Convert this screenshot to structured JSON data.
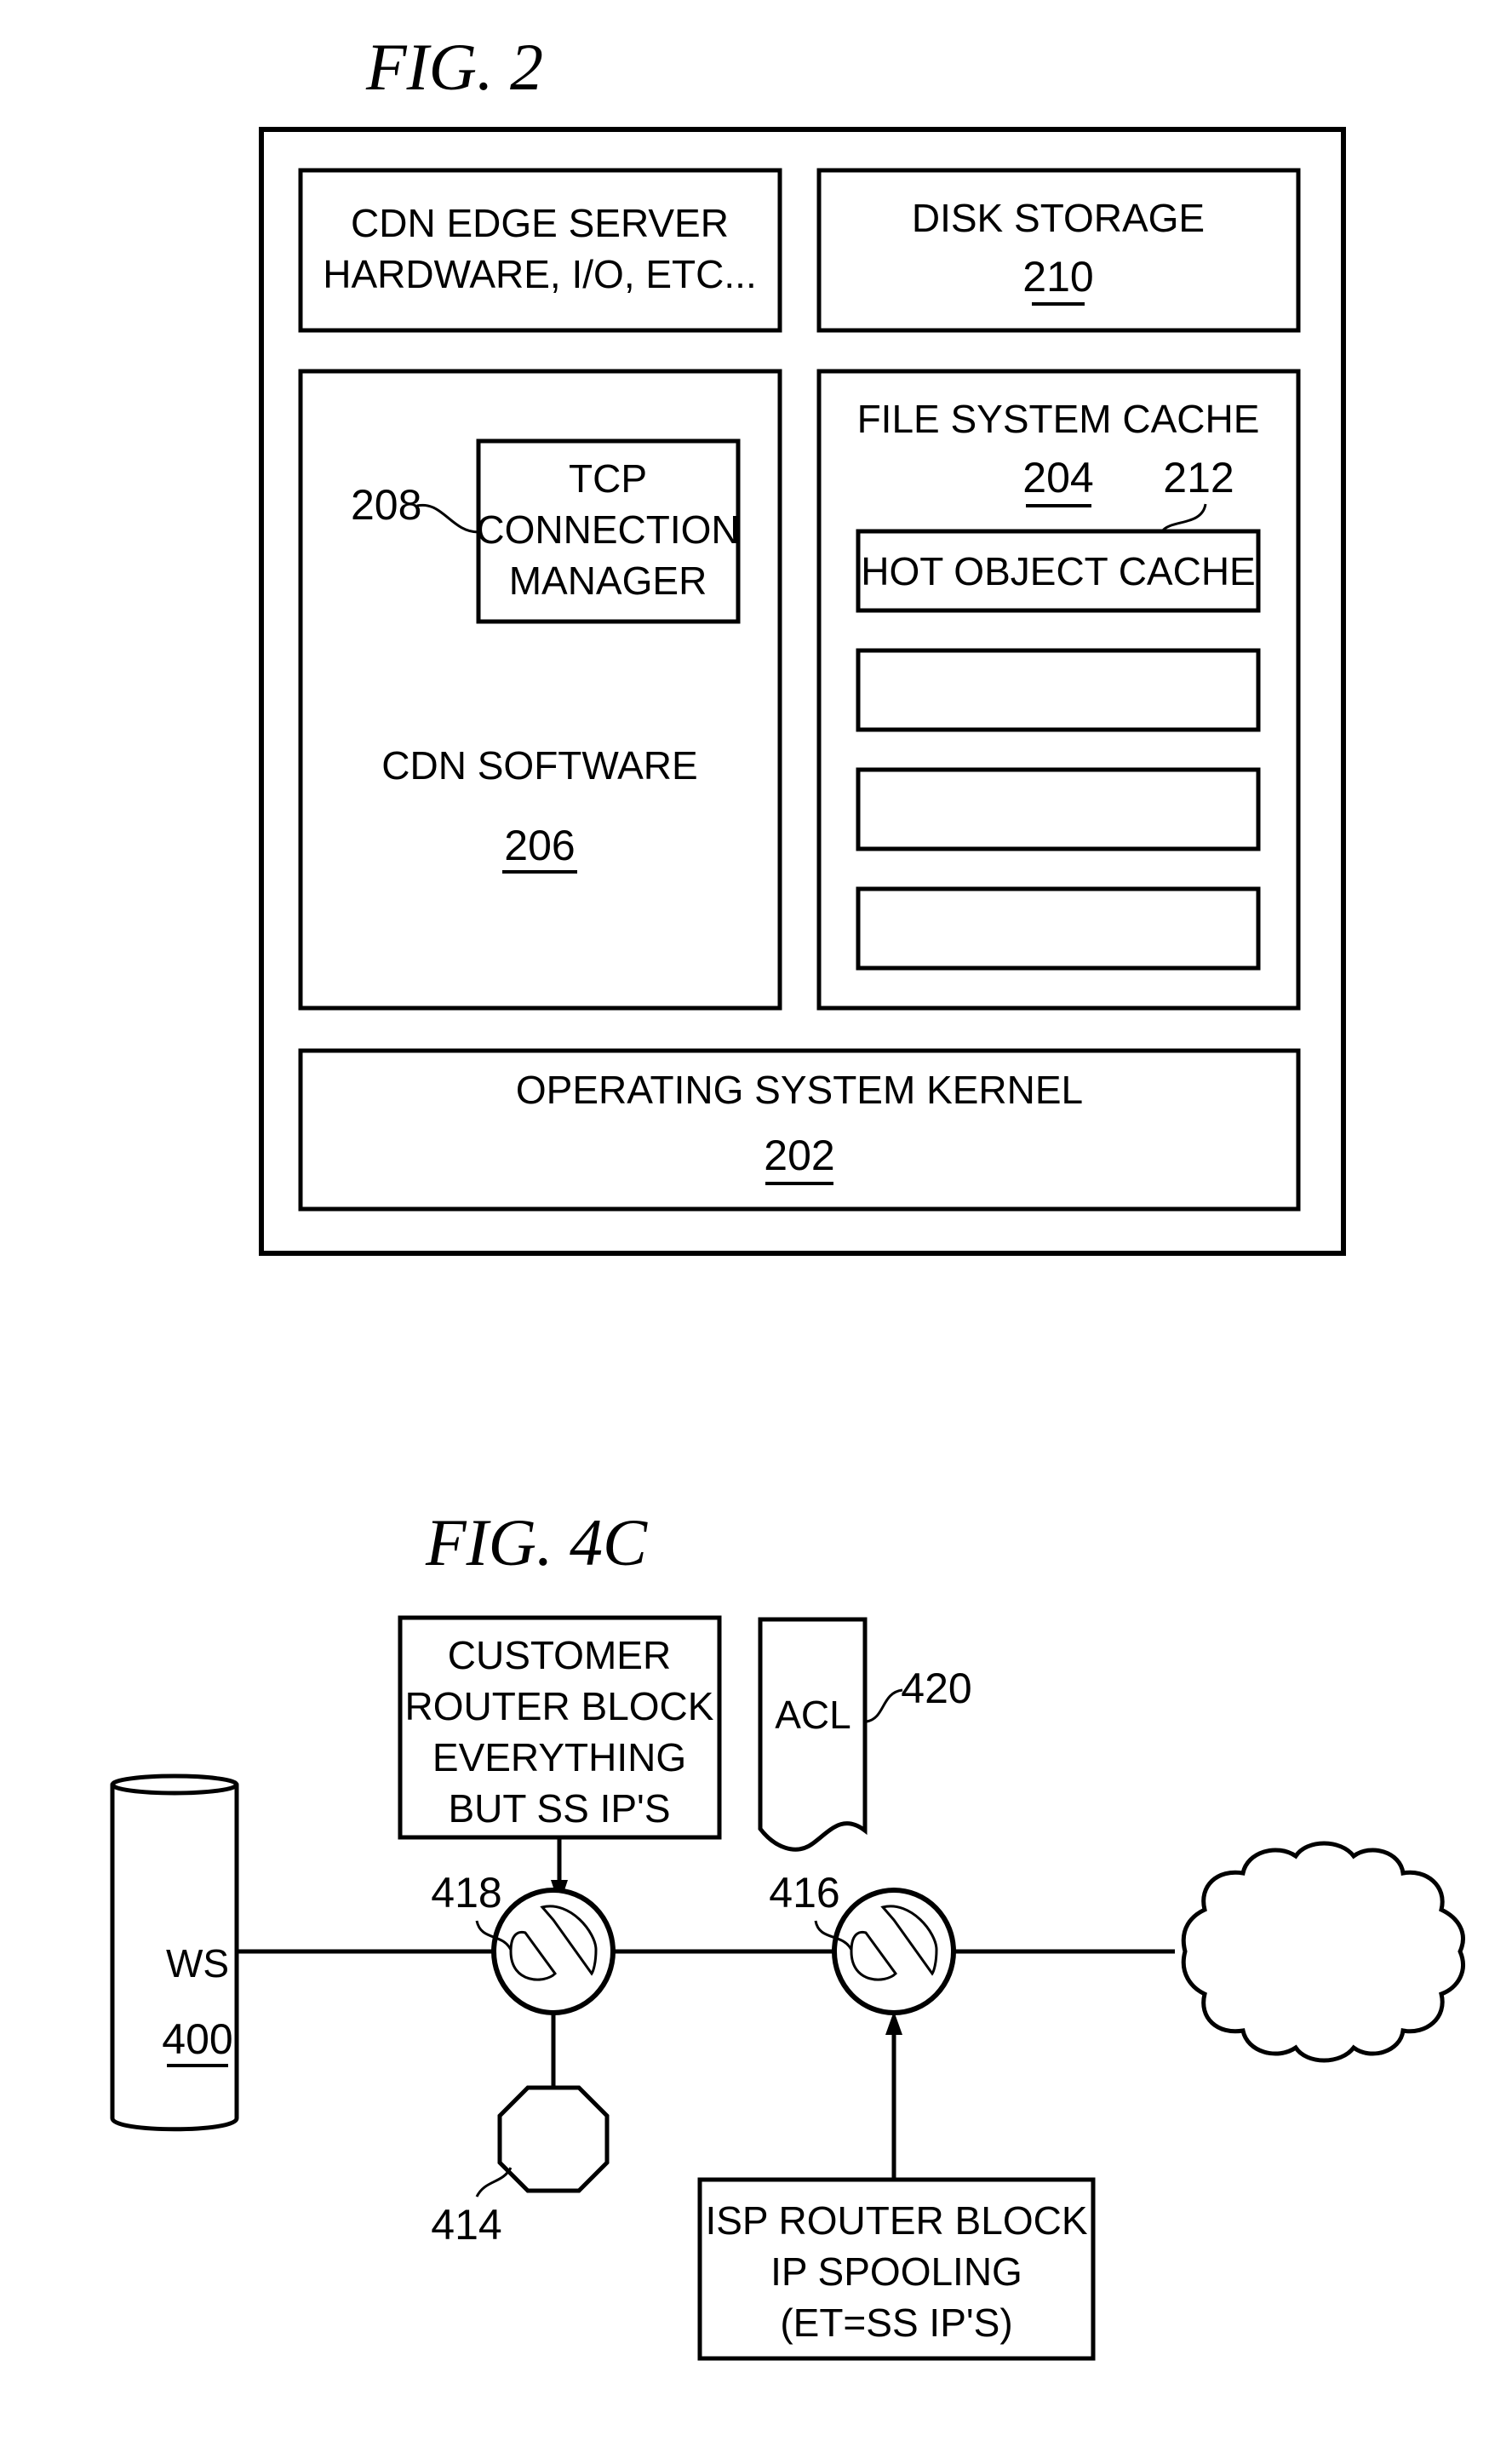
{
  "fig2": {
    "title": "FIG. 2",
    "edge_hardware": {
      "line1": "CDN EDGE SERVER",
      "line2": "HARDWARE, I/O, ETC..."
    },
    "disk_storage": {
      "label": "DISK STORAGE",
      "ref": "210"
    },
    "cdn_software": {
      "label": "CDN SOFTWARE",
      "ref": "206"
    },
    "tcp_manager": {
      "line1": "TCP",
      "line2": "CONNECTION",
      "line3": "MANAGER",
      "ref": "208"
    },
    "file_system_cache": {
      "label": "FILE SYSTEM CACHE",
      "ref": "204"
    },
    "hot_object_cache": {
      "label": "HOT OBJECT CACHE",
      "ref": "212",
      "empty_slots": 3
    },
    "os_kernel": {
      "label": "OPERATING SYSTEM KERNEL",
      "ref": "202"
    }
  },
  "fig4c": {
    "title": "FIG. 4C",
    "customer_router": {
      "line1": "CUSTOMER",
      "line2": "ROUTER BLOCK",
      "line3": "EVERYTHING",
      "line4": "BUT SS IP'S"
    },
    "acl": {
      "label": "ACL",
      "ref": "420"
    },
    "ws": {
      "label": "WS",
      "ref": "400"
    },
    "router_418": {
      "ref": "418"
    },
    "router_416": {
      "ref": "416"
    },
    "stop_node": {
      "ref": "414"
    },
    "isp_router": {
      "line1": "ISP ROUTER BLOCK",
      "line2": "IP SPOOLING",
      "line3": "(ET=SS IP'S)"
    },
    "internet_cloud": {
      "icon": "cloud-icon"
    }
  }
}
